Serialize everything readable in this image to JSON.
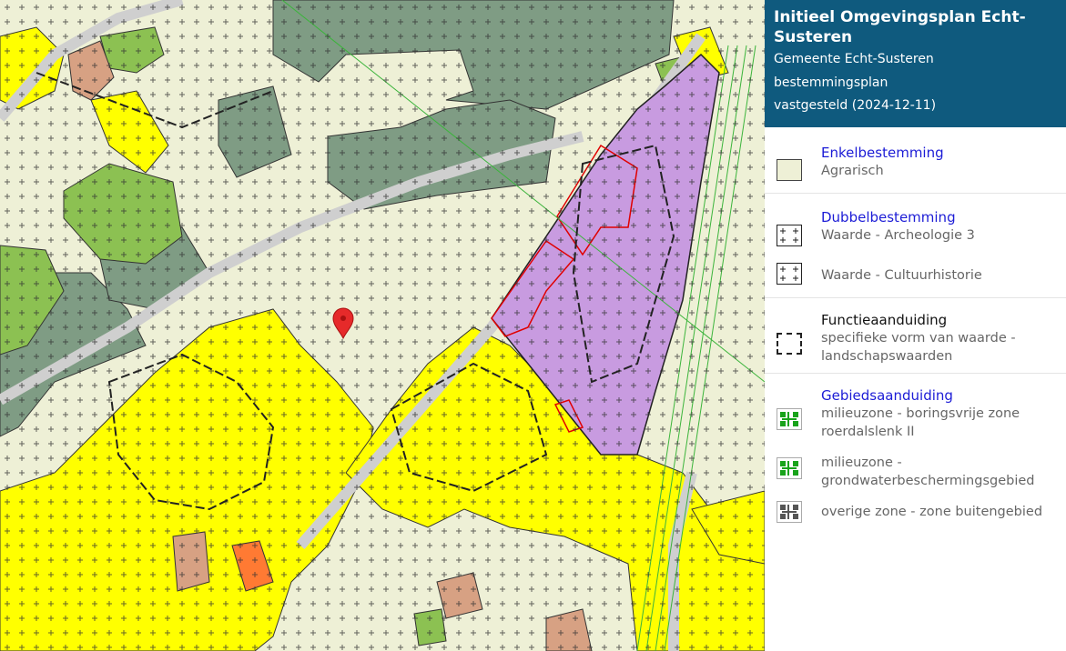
{
  "panel": {
    "title": "Initieel Omgevingsplan Echt-Susteren",
    "municipality": "Gemeente Echt-Susteren",
    "plan_type": "bestemmingsplan",
    "status": "vastgesteld (2024-12-11)"
  },
  "legend": {
    "enkel": {
      "title": "Enkelbestemming",
      "item": "Agrarisch"
    },
    "dubbel": {
      "title": "Dubbelbestemming",
      "items": [
        "Waarde - Archeologie 3",
        "Waarde - Cultuurhistorie"
      ]
    },
    "functie": {
      "title": "Functieaanduiding",
      "item": "specifieke vorm van waarde - landschapswaarden"
    },
    "gebied": {
      "title": "Gebiedsaanduiding",
      "items": [
        "milieuzone - boringsvrije zone roerdalslenk II",
        "milieuzone - grondwaterbeschermingsgebied",
        "overige zone - zone buitengebied"
      ]
    }
  },
  "colors": {
    "header_bg": "#0f5a7e",
    "agrarisch": "#eef0d6",
    "bos": "#7f9c84",
    "groen": "#8cc152",
    "wonen": "#ffff00",
    "gemengd": "#c89be0",
    "maatschappelijk": "#d7a183",
    "zone_green": "#19a31b",
    "marker": "#e62a2a"
  },
  "map": {
    "marker_icon": "map-pin-icon"
  }
}
